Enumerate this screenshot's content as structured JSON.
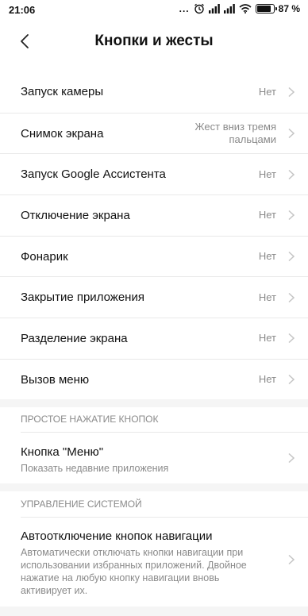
{
  "status_bar": {
    "time": "21:06",
    "dots": "...",
    "battery_percent_text": "87 %",
    "battery_level": 0.87
  },
  "header": {
    "title": "Кнопки и жесты"
  },
  "settings": [
    {
      "label": "Запуск камеры",
      "value": "Нет"
    },
    {
      "label": "Снимок экрана",
      "value": "Жест вниз тремя пальцами"
    },
    {
      "label": "Запуск Google Ассистента",
      "value": "Нет"
    },
    {
      "label": "Отключение экрана",
      "value": "Нет"
    },
    {
      "label": "Фонарик",
      "value": "Нет"
    },
    {
      "label": "Закрытие приложения",
      "value": "Нет"
    },
    {
      "label": "Разделение экрана",
      "value": "Нет"
    },
    {
      "label": "Вызов меню",
      "value": "Нет"
    }
  ],
  "section_simple_press": {
    "title": "ПРОСТОЕ НАЖАТИЕ КНОПОК",
    "item": {
      "label": "Кнопка \"Меню\"",
      "summary": "Показать недавние приложения"
    }
  },
  "section_system": {
    "title": "УПРАВЛЕНИЕ СИСТЕМОЙ",
    "item": {
      "label": "Автоотключение кнопок навигации",
      "summary_lines": [
        "Автоматически отключать кнопки навигации при",
        "использовании избранных приложений. Двойное",
        "нажатие на любую кнопку навигации вновь",
        "активирует их."
      ]
    }
  }
}
